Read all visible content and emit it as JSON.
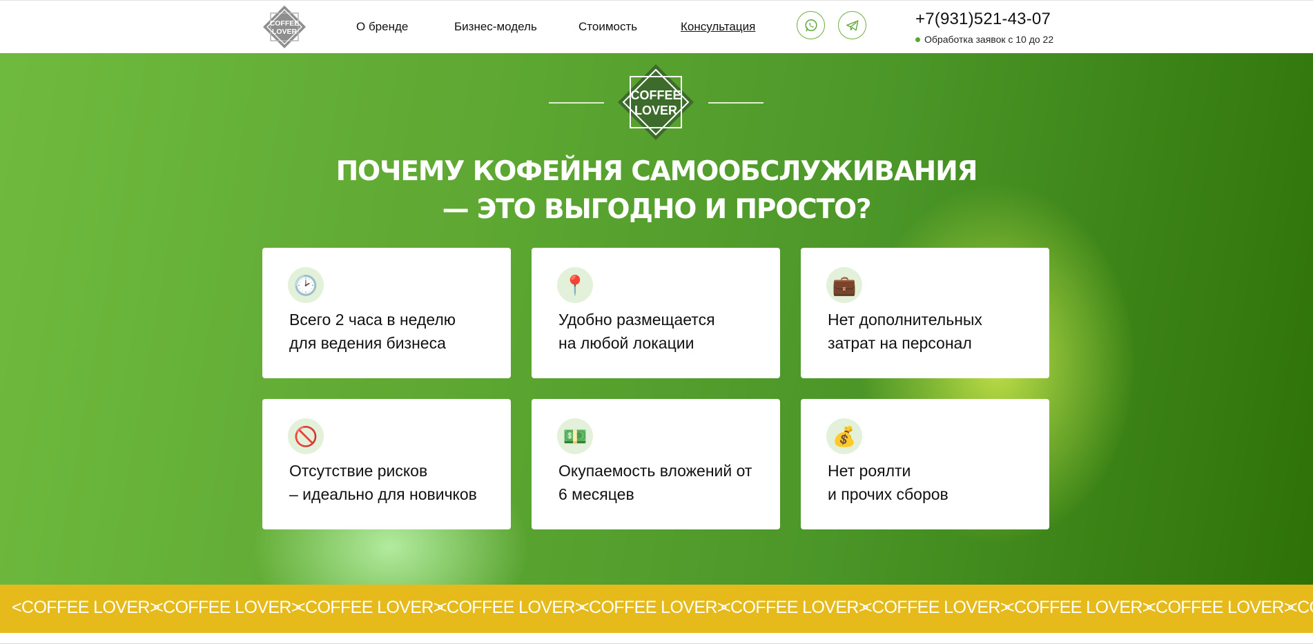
{
  "header": {
    "logo_text": [
      "COFFEE",
      "LOVER"
    ],
    "nav": [
      "О бренде",
      "Бизнес-модель",
      "Стоимость",
      "Консультация"
    ],
    "social": [
      "whatsapp-icon",
      "telegram-icon"
    ],
    "phone": "+7(931)521-43-07",
    "hours": "Обработка заявок с 10 до 22"
  },
  "hero": {
    "logo_text": [
      "COFFEE",
      "LOVER"
    ],
    "title_line1": "ПОЧЕМУ КОФЕЙНЯ САМООБСЛУЖИВАНИЯ",
    "title_line2": "— ЭТО ВЫГОДНО И ПРОСТО?",
    "cards": [
      {
        "icon": "clock-icon",
        "glyph": "🕑",
        "line1": "Всего 2 часа в неделю",
        "line2": "для ведения бизнеса"
      },
      {
        "icon": "pushpin-icon",
        "glyph": "📍",
        "line1": "Удобно размещается",
        "line2": "на любой локации"
      },
      {
        "icon": "briefcase-icon",
        "glyph": "💼",
        "line1": "Нет дополнительных",
        "line2": "затрат на персонал"
      },
      {
        "icon": "no-entry-icon",
        "glyph": "🚫",
        "line1": "Отсутствие рисков",
        "line2": "– идеально для новичков"
      },
      {
        "icon": "money-icon",
        "glyph": "💵",
        "line1": "Окупаемость вложений от",
        "line2": "6 месяцев"
      },
      {
        "icon": "money-bag-icon",
        "glyph": "💰",
        "line1": "Нет роялти",
        "line2": "и прочих сборов"
      }
    ]
  },
  "marquee": {
    "items": [
      "<COFFEE LOVER>",
      "<COFFEE LOVER>",
      "<COFFEE LOVER>",
      "<COFFEE LOVER>",
      "<COFFEE LOVER>",
      "<COFFEE LOVER>",
      "<COFFEE LOVER>",
      "<COFFEE LOVER>",
      "<COFFEE LOVER>",
      "<COFFEE LOVER>"
    ]
  },
  "colors": {
    "accent_green": "#5aa533",
    "hero_green_light": "#6fba3e",
    "hero_green_dark": "#2e7207",
    "marquee_yellow": "#e5ba1a",
    "logo_green": "#3d6b2c"
  }
}
